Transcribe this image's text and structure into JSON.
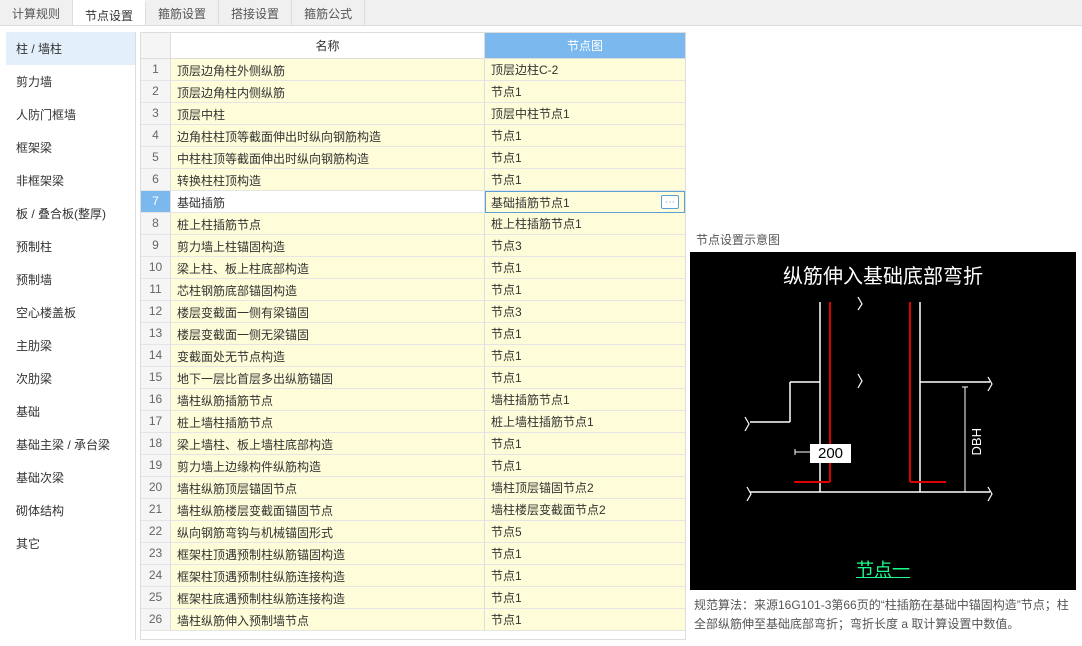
{
  "top_tabs": [
    "计算规则",
    "节点设置",
    "箍筋设置",
    "搭接设置",
    "箍筋公式"
  ],
  "active_top_tab": 1,
  "sidebar": {
    "items": [
      "柱 / 墙柱",
      "剪力墙",
      "人防门框墙",
      "框架梁",
      "非框架梁",
      "板 / 叠合板(整厚)",
      "预制柱",
      "预制墙",
      "空心楼盖板",
      "主肋梁",
      "次肋梁",
      "基础",
      "基础主梁 / 承台梁",
      "基础次梁",
      "砌体结构",
      "其它"
    ],
    "active": 0
  },
  "table": {
    "headers": {
      "name": "名称",
      "node": "节点图"
    },
    "selected": 6,
    "rows": [
      {
        "num": 1,
        "name": "顶层边角柱外侧纵筋",
        "node": "顶层边柱C-2"
      },
      {
        "num": 2,
        "name": "顶层边角柱内侧纵筋",
        "node": "节点1"
      },
      {
        "num": 3,
        "name": "顶层中柱",
        "node": "顶层中柱节点1"
      },
      {
        "num": 4,
        "name": "边角柱柱顶等截面伸出时纵向钢筋构造",
        "node": "节点1"
      },
      {
        "num": 5,
        "name": "中柱柱顶等截面伸出时纵向钢筋构造",
        "node": "节点1"
      },
      {
        "num": 6,
        "name": "转换柱柱顶构造",
        "node": "节点1"
      },
      {
        "num": 7,
        "name": "基础插筋",
        "node": "基础插筋节点1"
      },
      {
        "num": 8,
        "name": "桩上柱插筋节点",
        "node": "桩上柱插筋节点1"
      },
      {
        "num": 9,
        "name": "剪力墙上柱锚固构造",
        "node": "节点3"
      },
      {
        "num": 10,
        "name": "梁上柱、板上柱底部构造",
        "node": "节点1"
      },
      {
        "num": 11,
        "name": "芯柱钢筋底部锚固构造",
        "node": "节点1"
      },
      {
        "num": 12,
        "name": "楼层变截面一侧有梁锚固",
        "node": "节点3"
      },
      {
        "num": 13,
        "name": "楼层变截面一侧无梁锚固",
        "node": "节点1"
      },
      {
        "num": 14,
        "name": "变截面处无节点构造",
        "node": "节点1"
      },
      {
        "num": 15,
        "name": "地下一层比首层多出纵筋锚固",
        "node": "节点1"
      },
      {
        "num": 16,
        "name": "墙柱纵筋插筋节点",
        "node": "墙柱插筋节点1"
      },
      {
        "num": 17,
        "name": "桩上墙柱插筋节点",
        "node": "桩上墙柱插筋节点1"
      },
      {
        "num": 18,
        "name": "梁上墙柱、板上墙柱底部构造",
        "node": "节点1"
      },
      {
        "num": 19,
        "name": "剪力墙上边缘构件纵筋构造",
        "node": "节点1"
      },
      {
        "num": 20,
        "name": "墙柱纵筋顶层锚固节点",
        "node": "墙柱顶层锚固节点2"
      },
      {
        "num": 21,
        "name": "墙柱纵筋楼层变截面锚固节点",
        "node": "墙柱楼层变截面节点2"
      },
      {
        "num": 22,
        "name": "纵向钢筋弯钩与机械锚固形式",
        "node": "节点5"
      },
      {
        "num": 23,
        "name": "框架柱顶遇预制柱纵筋锚固构造",
        "node": "节点1"
      },
      {
        "num": 24,
        "name": "框架柱顶遇预制柱纵筋连接构造",
        "node": "节点1"
      },
      {
        "num": 25,
        "name": "框架柱底遇预制柱纵筋连接构造",
        "node": "节点1"
      },
      {
        "num": 26,
        "name": "墙柱纵筋伸入预制墙节点",
        "node": "节点1"
      }
    ]
  },
  "right_panel": {
    "title": "节点设置示意图",
    "caption": "纵筋伸入基础底部弯折",
    "value_label": "200",
    "dbh_label": "DBH",
    "node_label": "节点一",
    "description": "规范算法：来源16G101-3第66页的“柱插筋在基础中锚固构造”节点；柱全部纵筋伸至基础底部弯折；弯折长度 a 取计算设置中数值。"
  }
}
